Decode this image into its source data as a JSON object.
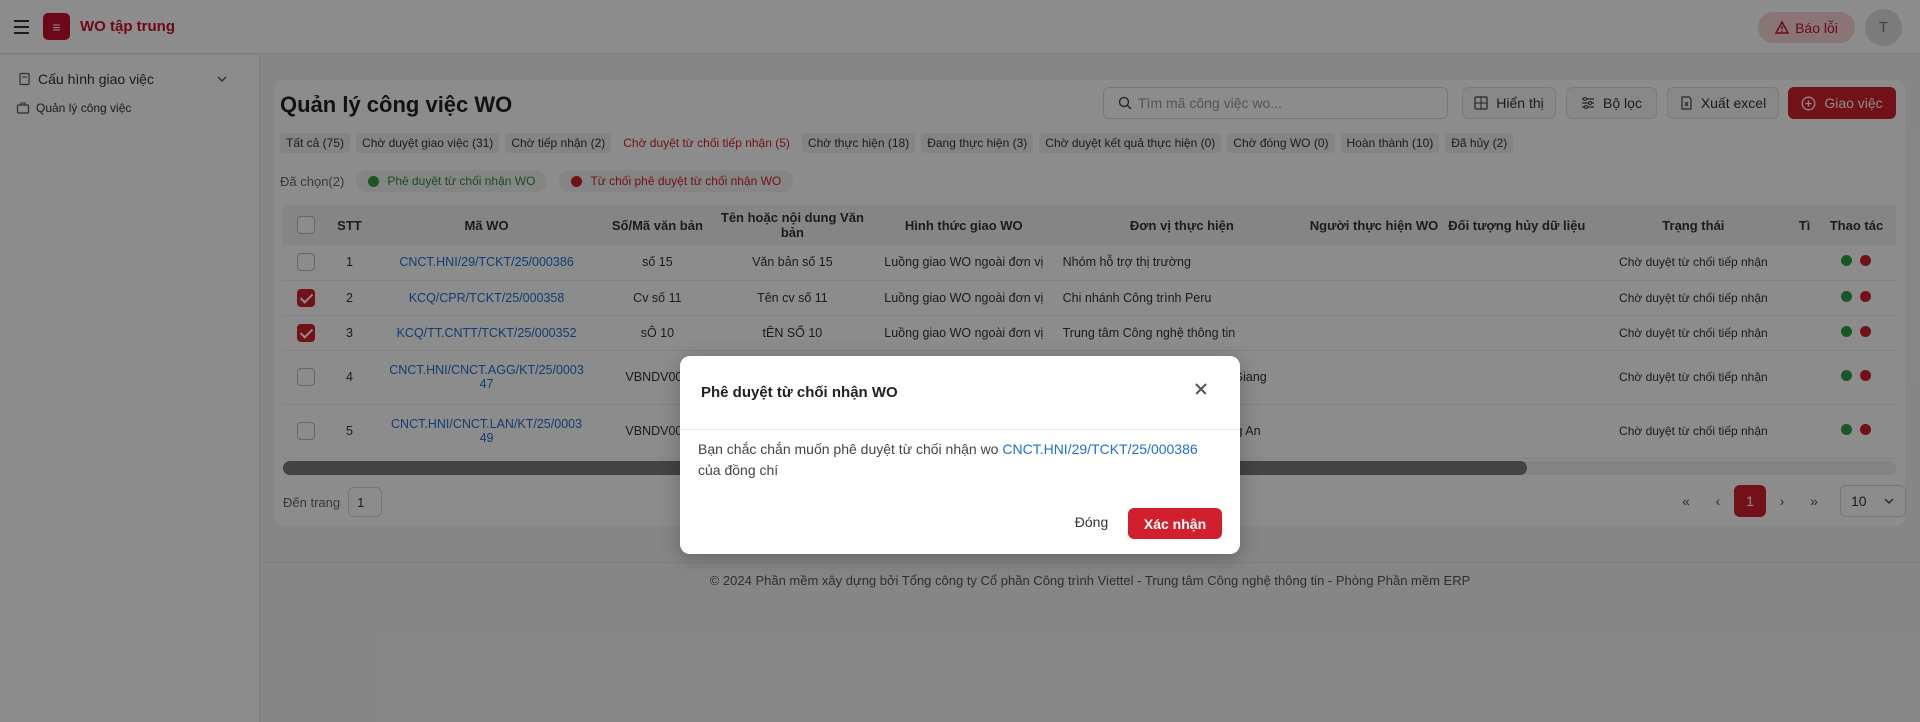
{
  "app": {
    "title": "WO tập trung",
    "logo_text": "≡",
    "report_label": "Báo lỗi",
    "avatar_initial": "T"
  },
  "sidebar": {
    "group_label": "Cấu hình giao việc",
    "item_label": "Quản lý công việc"
  },
  "page": {
    "title": "Quản lý công việc WO"
  },
  "toolbar": {
    "search_placeholder": "Tìm mã công việc wo...",
    "display_label": "Hiển thị",
    "filter_label": "Bộ lọc",
    "export_label": "Xuất excel",
    "assign_label": "Giao việc"
  },
  "tabs": [
    "Tất cả (75)",
    "Chờ duyệt giao việc (31)",
    "Chờ tiếp nhận (2)",
    "Chờ duyệt từ chối tiếp nhận (5)",
    "Chờ thực hiện (18)",
    "Đang thực hiện (3)",
    "Chờ duyệt kết quả thực hiện (0)",
    "Chờ đóng WO (0)",
    "Hoàn thành (10)",
    "Đã hủy (2)"
  ],
  "selection": {
    "label": "Đã chọn(2)",
    "approve_chip": "Phê duyệt từ chối nhận WO",
    "reject_chip": "Từ chối phê duyệt từ chối nhận WO"
  },
  "table": {
    "headers": [
      "STT",
      "Mã WO",
      "Số/Mã văn bản",
      "Tên hoặc nội dung Văn bản",
      "Hình thức giao WO",
      "Đơn vị thực hiện",
      "Người thực hiện WO",
      "Đối tượng hủy dữ liệu",
      "Trạng thái",
      "Tì",
      "Thao tác"
    ],
    "rows": [
      {
        "stt": "1",
        "ma": "CNCT.HNI/29/TCKT/25/000386",
        "so": "số 15",
        "ten": "Văn bản số 15",
        "hinh_thuc": "Luồng giao WO ngoài đơn vị",
        "don_vi": "Nhóm hỗ trợ thị trường",
        "trang_thai": "Chờ duyệt từ chối tiếp nhận",
        "checked": false
      },
      {
        "stt": "2",
        "ma": "KCQ/CPR/TCKT/25/000358",
        "so": "Cv số 11",
        "ten": "Tên cv số 11",
        "hinh_thuc": "Luồng giao WO ngoài đơn vị",
        "don_vi": "Chi nhánh Công trình Peru",
        "trang_thai": "Chờ duyệt từ chối tiếp nhận",
        "checked": true
      },
      {
        "stt": "3",
        "ma": "KCQ/TT.CNTT/TCKT/25/000352",
        "so": "sÔ 10",
        "ten": "tÊN SỐ 10",
        "hinh_thuc": "Luồng giao WO ngoài đơn vị",
        "don_vi": "Trung tâm Công nghệ thông tin",
        "trang_thai": "Chờ duyệt từ chối tiếp nhận",
        "checked": true
      },
      {
        "stt": "4",
        "ma_1": "CNCT.HNI/CNCT.AGG/KT/25/0003",
        "ma_2": "47",
        "so": "VBNDV003",
        "don_vi": "An Giang",
        "trang_thai": "Chờ duyệt từ chối tiếp nhận",
        "checked": false
      },
      {
        "stt": "5",
        "ma_1": "CNCT.HNI/CNCT.LAN/KT/25/0003",
        "ma_2": "49",
        "so": "VBNDV003",
        "don_vi": "Long An",
        "trang_thai": "Chờ duyệt từ chối tiếp nhận",
        "checked": false
      }
    ]
  },
  "pagination": {
    "goto_label": "Đến trang",
    "goto_value": "1",
    "current": "1",
    "page_size": "10"
  },
  "footer": "© 2024 Phần mềm xây dựng bởi Tổng công ty Cổ phần Công trình Viettel - Trung tâm Công nghệ thông tin - Phòng Phần mềm ERP",
  "modal": {
    "title": "Phê duyệt từ chối nhận WO",
    "body_prefix": "Bạn chắc chắn muốn phê duyệt từ chối nhận wo ",
    "wo_code": "CNCT.HNI/29/TCKT/25/000386",
    "body_suffix": " của đồng chí",
    "close_label": "Đóng",
    "confirm_label": "Xác nhận"
  },
  "colors": {
    "accent": "#d11f2d",
    "link": "#1f6fd1",
    "success": "#2e9e44"
  }
}
